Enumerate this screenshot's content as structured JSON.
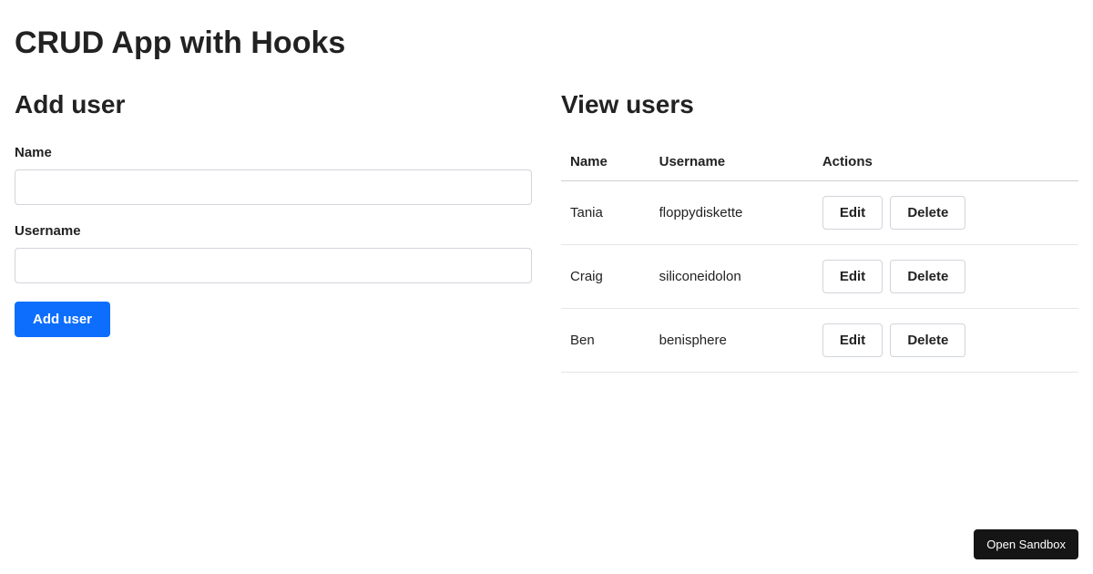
{
  "page_title": "CRUD App with Hooks",
  "form": {
    "heading": "Add user",
    "name_label": "Name",
    "name_value": "",
    "username_label": "Username",
    "username_value": "",
    "submit_label": "Add user"
  },
  "table": {
    "heading": "View users",
    "columns": {
      "name": "Name",
      "username": "Username",
      "actions": "Actions"
    },
    "edit_label": "Edit",
    "delete_label": "Delete",
    "rows": [
      {
        "name": "Tania",
        "username": "floppydiskette"
      },
      {
        "name": "Craig",
        "username": "siliconeidolon"
      },
      {
        "name": "Ben",
        "username": "benisphere"
      }
    ]
  },
  "sandbox_button": "Open Sandbox"
}
